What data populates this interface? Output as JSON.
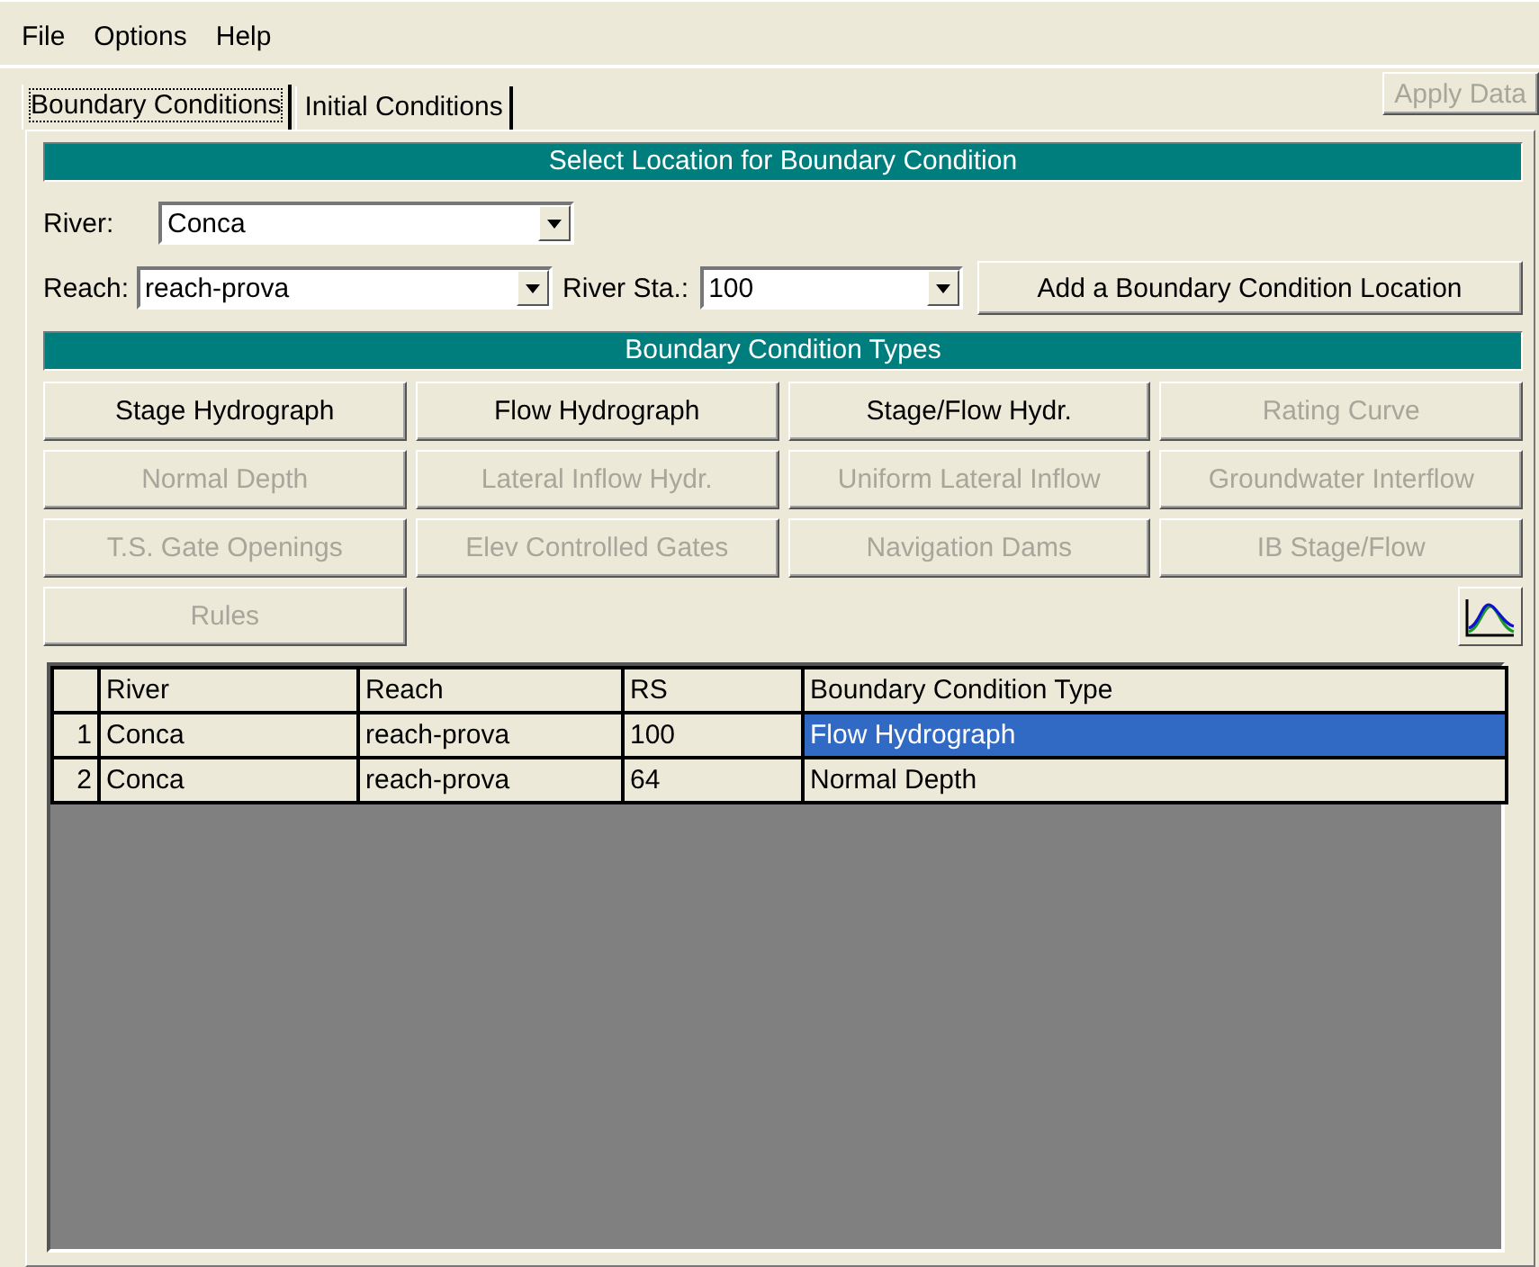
{
  "menu": [
    "File",
    "Options",
    "Help"
  ],
  "tabs": [
    {
      "label": "Boundary Conditions",
      "selected": true
    },
    {
      "label": "Initial Conditions",
      "selected": false
    }
  ],
  "apply_button": {
    "label": "Apply Data",
    "disabled": true
  },
  "location_header": "Select Location for Boundary Condition",
  "river": {
    "label": "River:",
    "value": "Conca"
  },
  "reach": {
    "label": "Reach:",
    "value": "reach-prova"
  },
  "river_station": {
    "label": "River Sta.:",
    "value": "100"
  },
  "add_location_button": {
    "label": "Add a Boundary Condition Location",
    "disabled": false
  },
  "types_header": "Boundary Condition Types",
  "type_buttons": [
    {
      "label": "Stage Hydrograph",
      "disabled": false
    },
    {
      "label": "Flow Hydrograph",
      "disabled": false
    },
    {
      "label": "Stage/Flow Hydr.",
      "disabled": false
    },
    {
      "label": "Rating Curve",
      "disabled": true
    },
    {
      "label": "Normal Depth",
      "disabled": true
    },
    {
      "label": "Lateral Inflow Hydr.",
      "disabled": true
    },
    {
      "label": "Uniform Lateral Inflow",
      "disabled": true
    },
    {
      "label": "Groundwater Interflow",
      "disabled": true
    },
    {
      "label": "T.S. Gate Openings",
      "disabled": true
    },
    {
      "label": "Elev Controlled Gates",
      "disabled": true
    },
    {
      "label": "Navigation Dams",
      "disabled": true
    },
    {
      "label": "IB Stage/Flow",
      "disabled": true
    },
    {
      "label": "Rules",
      "disabled": true
    }
  ],
  "table": {
    "columns": [
      "River",
      "Reach",
      "RS",
      "Boundary Condition Type"
    ],
    "rows": [
      {
        "number": "1",
        "cells": [
          "Conca",
          "reach-prova",
          "100",
          "Flow Hydrograph"
        ],
        "selected": true
      },
      {
        "number": "2",
        "cells": [
          "Conca",
          "reach-prova",
          "64",
          "Normal Depth"
        ],
        "selected": false
      }
    ]
  }
}
